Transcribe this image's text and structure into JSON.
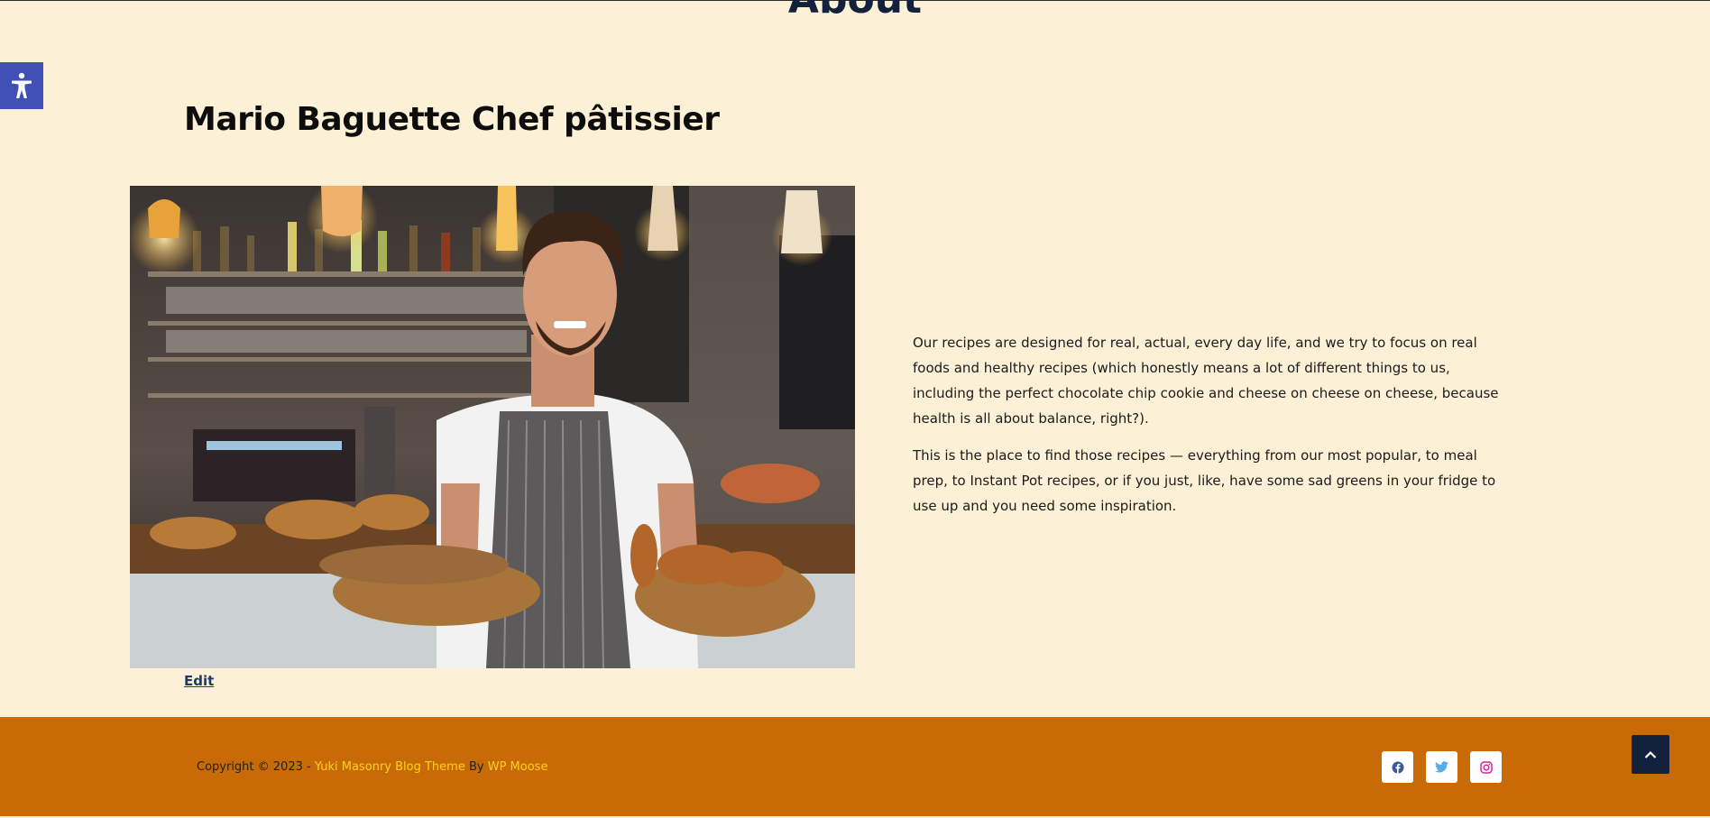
{
  "page": {
    "title": "About"
  },
  "accessibility": {
    "icon": "accessibility-icon"
  },
  "content": {
    "heading": "Mario Baguette Chef pâtissier",
    "image_icon": "chef-photo",
    "paragraphs": [
      "Our recipes are designed for real, actual, every day life, and we try to focus on real foods and healthy recipes (which honestly means a lot of different things to us, including the perfect chocolate chip cookie and cheese on cheese on cheese, because health is all about balance, right?).",
      "This is the place to find those recipes — everything from our most popular, to meal prep, to Instant Pot recipes, or if you just, like, have some sad greens in your fridge to use up and you need some inspiration."
    ],
    "edit_label": "Edit"
  },
  "footer": {
    "copyright_prefix": "Copyright © 2023 - ",
    "theme_link": "Yuki Masonry Blog Theme",
    "by": " By ",
    "author_link": "WP Moose",
    "social": [
      "facebook-icon",
      "twitter-icon",
      "instagram-icon"
    ]
  },
  "colors": {
    "background": "#fcf1d6",
    "footer": "#c86b06",
    "accent_link": "#ffd21a",
    "navy": "#14213d",
    "a11y_blue": "#3f51b5"
  }
}
